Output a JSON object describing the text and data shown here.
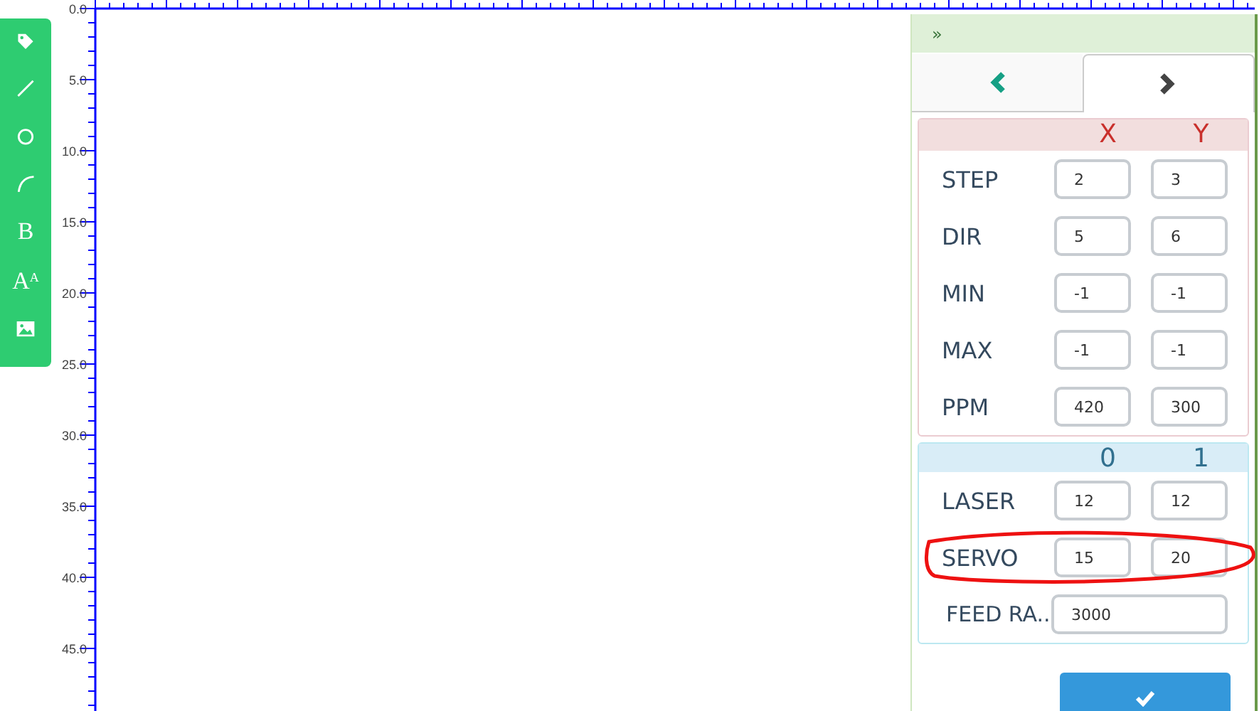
{
  "ruler": {
    "labels": [
      "0.0",
      "5.0",
      "10.0",
      "15.0",
      "20.0",
      "25.0",
      "30.0",
      "35.0",
      "40.0",
      "45.0"
    ]
  },
  "toolbar": [
    {
      "kind": "tag"
    },
    {
      "kind": "line"
    },
    {
      "kind": "circle"
    },
    {
      "kind": "arc"
    },
    {
      "kind": "bold",
      "label": "B"
    },
    {
      "kind": "text-size",
      "label": "A",
      "small": "A"
    },
    {
      "kind": "image"
    }
  ],
  "panel": {
    "collapse": "»",
    "tabs": [
      {
        "kind": "previous",
        "selected": false
      },
      {
        "kind": "next",
        "selected": true
      }
    ],
    "axes": {
      "columns": [
        "X",
        "Y"
      ],
      "rows": [
        {
          "label": "STEP",
          "values": [
            "2",
            "3"
          ]
        },
        {
          "label": "DIR",
          "values": [
            "5",
            "6"
          ]
        },
        {
          "label": "MIN",
          "values": [
            "-1",
            "-1"
          ]
        },
        {
          "label": "MAX",
          "values": [
            "-1",
            "-1"
          ]
        },
        {
          "label": "PPM",
          "values": [
            "420",
            "300"
          ]
        }
      ]
    },
    "tools": {
      "columns": [
        "0",
        "1"
      ],
      "rows": [
        {
          "label": "LASER",
          "values": [
            "12",
            "12"
          ],
          "circled": false
        },
        {
          "label": "SERVO",
          "values": [
            "15",
            "20"
          ],
          "circled": true
        },
        {
          "label": "FEED RA..",
          "values": [
            "3000"
          ],
          "circled": false
        }
      ]
    }
  }
}
